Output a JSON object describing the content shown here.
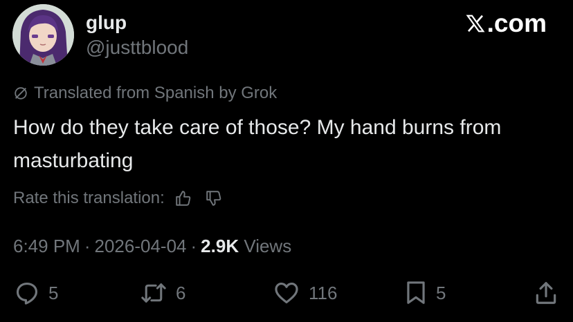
{
  "author": {
    "display_name": "glup",
    "handle": "@justtblood"
  },
  "brand": {
    "label": ".com",
    "icon": "x-logo-icon"
  },
  "translation": {
    "notice": "Translated from Spanish by Grok",
    "rate_label": "Rate this translation:"
  },
  "tweet": {
    "text": "How do they take care of those? My hand burns from masturbating"
  },
  "meta": {
    "time": "6:49 PM",
    "separator": "·",
    "date": "2026-04-04",
    "views_count": "2.9K",
    "views_label": "Views"
  },
  "actions": {
    "replies": "5",
    "reposts": "6",
    "likes": "116",
    "bookmarks": "5"
  },
  "colors": {
    "background": "#000000",
    "primary_text": "#e7e9ea",
    "secondary_text": "#71767b"
  }
}
